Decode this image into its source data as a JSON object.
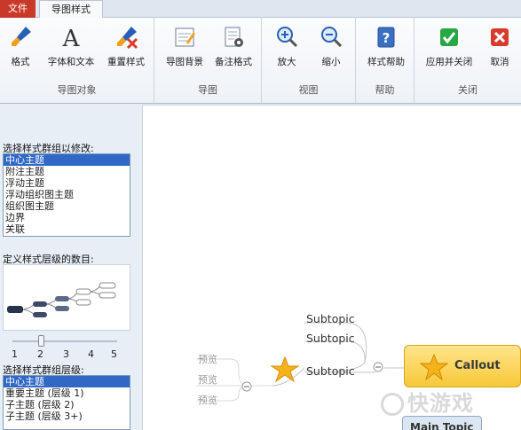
{
  "tabs": {
    "file": "文件",
    "mindmap_style": "导图样式"
  },
  "ribbon": {
    "groups": [
      {
        "label": "导图对象",
        "buttons": [
          {
            "label": "格式",
            "icon": "format-brush-icon"
          },
          {
            "label": "字体和文本",
            "icon": "font-a-icon"
          },
          {
            "label": "重置样式",
            "icon": "reset-brush-icon"
          }
        ]
      },
      {
        "label": "导图",
        "buttons": [
          {
            "label": "导图背景",
            "icon": "map-background-icon"
          },
          {
            "label": "备注格式",
            "icon": "note-format-icon"
          }
        ]
      },
      {
        "label": "视图",
        "buttons": [
          {
            "label": "放大",
            "icon": "zoom-in-icon"
          },
          {
            "label": "缩小",
            "icon": "zoom-out-icon"
          }
        ]
      },
      {
        "label": "帮助",
        "buttons": [
          {
            "label": "样式帮助",
            "icon": "help-book-icon"
          }
        ]
      },
      {
        "label": "关闭",
        "buttons": [
          {
            "label": "应用并关闭",
            "icon": "apply-check-icon"
          },
          {
            "label": "取消",
            "icon": "cancel-x-icon"
          }
        ]
      }
    ]
  },
  "panel": {
    "select_group_label": "选择样式群组以修改:",
    "group_items": [
      "中心主题",
      "附注主题",
      "浮动主题",
      "浮动组织图主题",
      "组织图主题",
      "边界",
      "关联"
    ],
    "group_selected": "中心主题",
    "levels_label": "定义样式层级的数目:",
    "slider_value": 2,
    "slider_ticks": [
      "1",
      "2",
      "3",
      "4",
      "5"
    ],
    "level_label": "选择样式群组层级:",
    "level_items": [
      "中心主题",
      "重要主题 (层级 1)",
      "子主题 (层级 2)",
      "子主题 (层级 3+)"
    ],
    "level_selected": "中心主题"
  },
  "canvas": {
    "subtopics": [
      "Subtopic",
      "Subtopic",
      "Subtopic"
    ],
    "previews": [
      "预览",
      "预览",
      "预览"
    ],
    "callout": "Callout",
    "main_topic": "Main Topic",
    "watermark": "快游戏"
  },
  "colors": {
    "file_tab": "#c8392a",
    "callout_fill": "#f8c838",
    "star": "#f5b21a",
    "selection": "#3168c6",
    "apply": "#27a844",
    "cancel": "#d83b2b"
  }
}
